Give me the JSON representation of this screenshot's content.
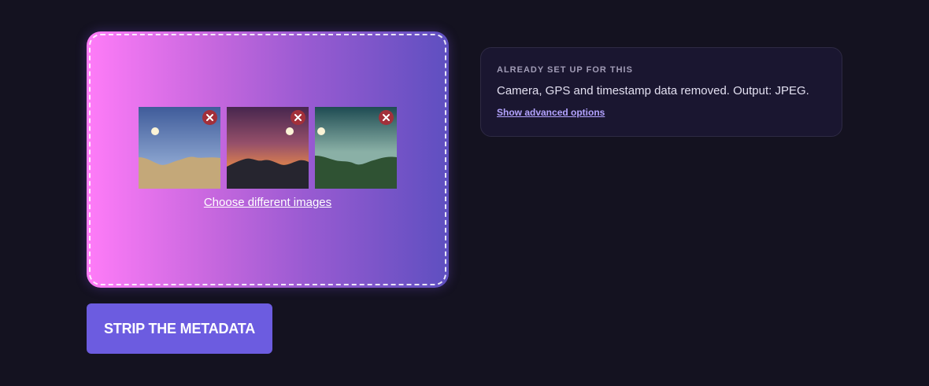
{
  "dropzone": {
    "images": [
      {
        "name": "desert-scene",
        "remove_icon": "close-icon"
      },
      {
        "name": "sunset-scene",
        "remove_icon": "close-icon"
      },
      {
        "name": "forest-scene",
        "remove_icon": "close-icon"
      }
    ],
    "choose_link": "Choose different images"
  },
  "primary_action": {
    "label": "STRIP THE METADATA"
  },
  "info_card": {
    "heading": "ALREADY SET UP FOR THIS",
    "description": "Camera, GPS and timestamp data removed. Output: JPEG.",
    "advanced_link": "Show advanced options"
  },
  "colors": {
    "background": "#141220",
    "gradient_start": "#ff7cf8",
    "gradient_end": "#5e4fc0",
    "button": "#6c5ce0",
    "remove_badge": "#a3303a",
    "link": "#b3a3ff"
  }
}
